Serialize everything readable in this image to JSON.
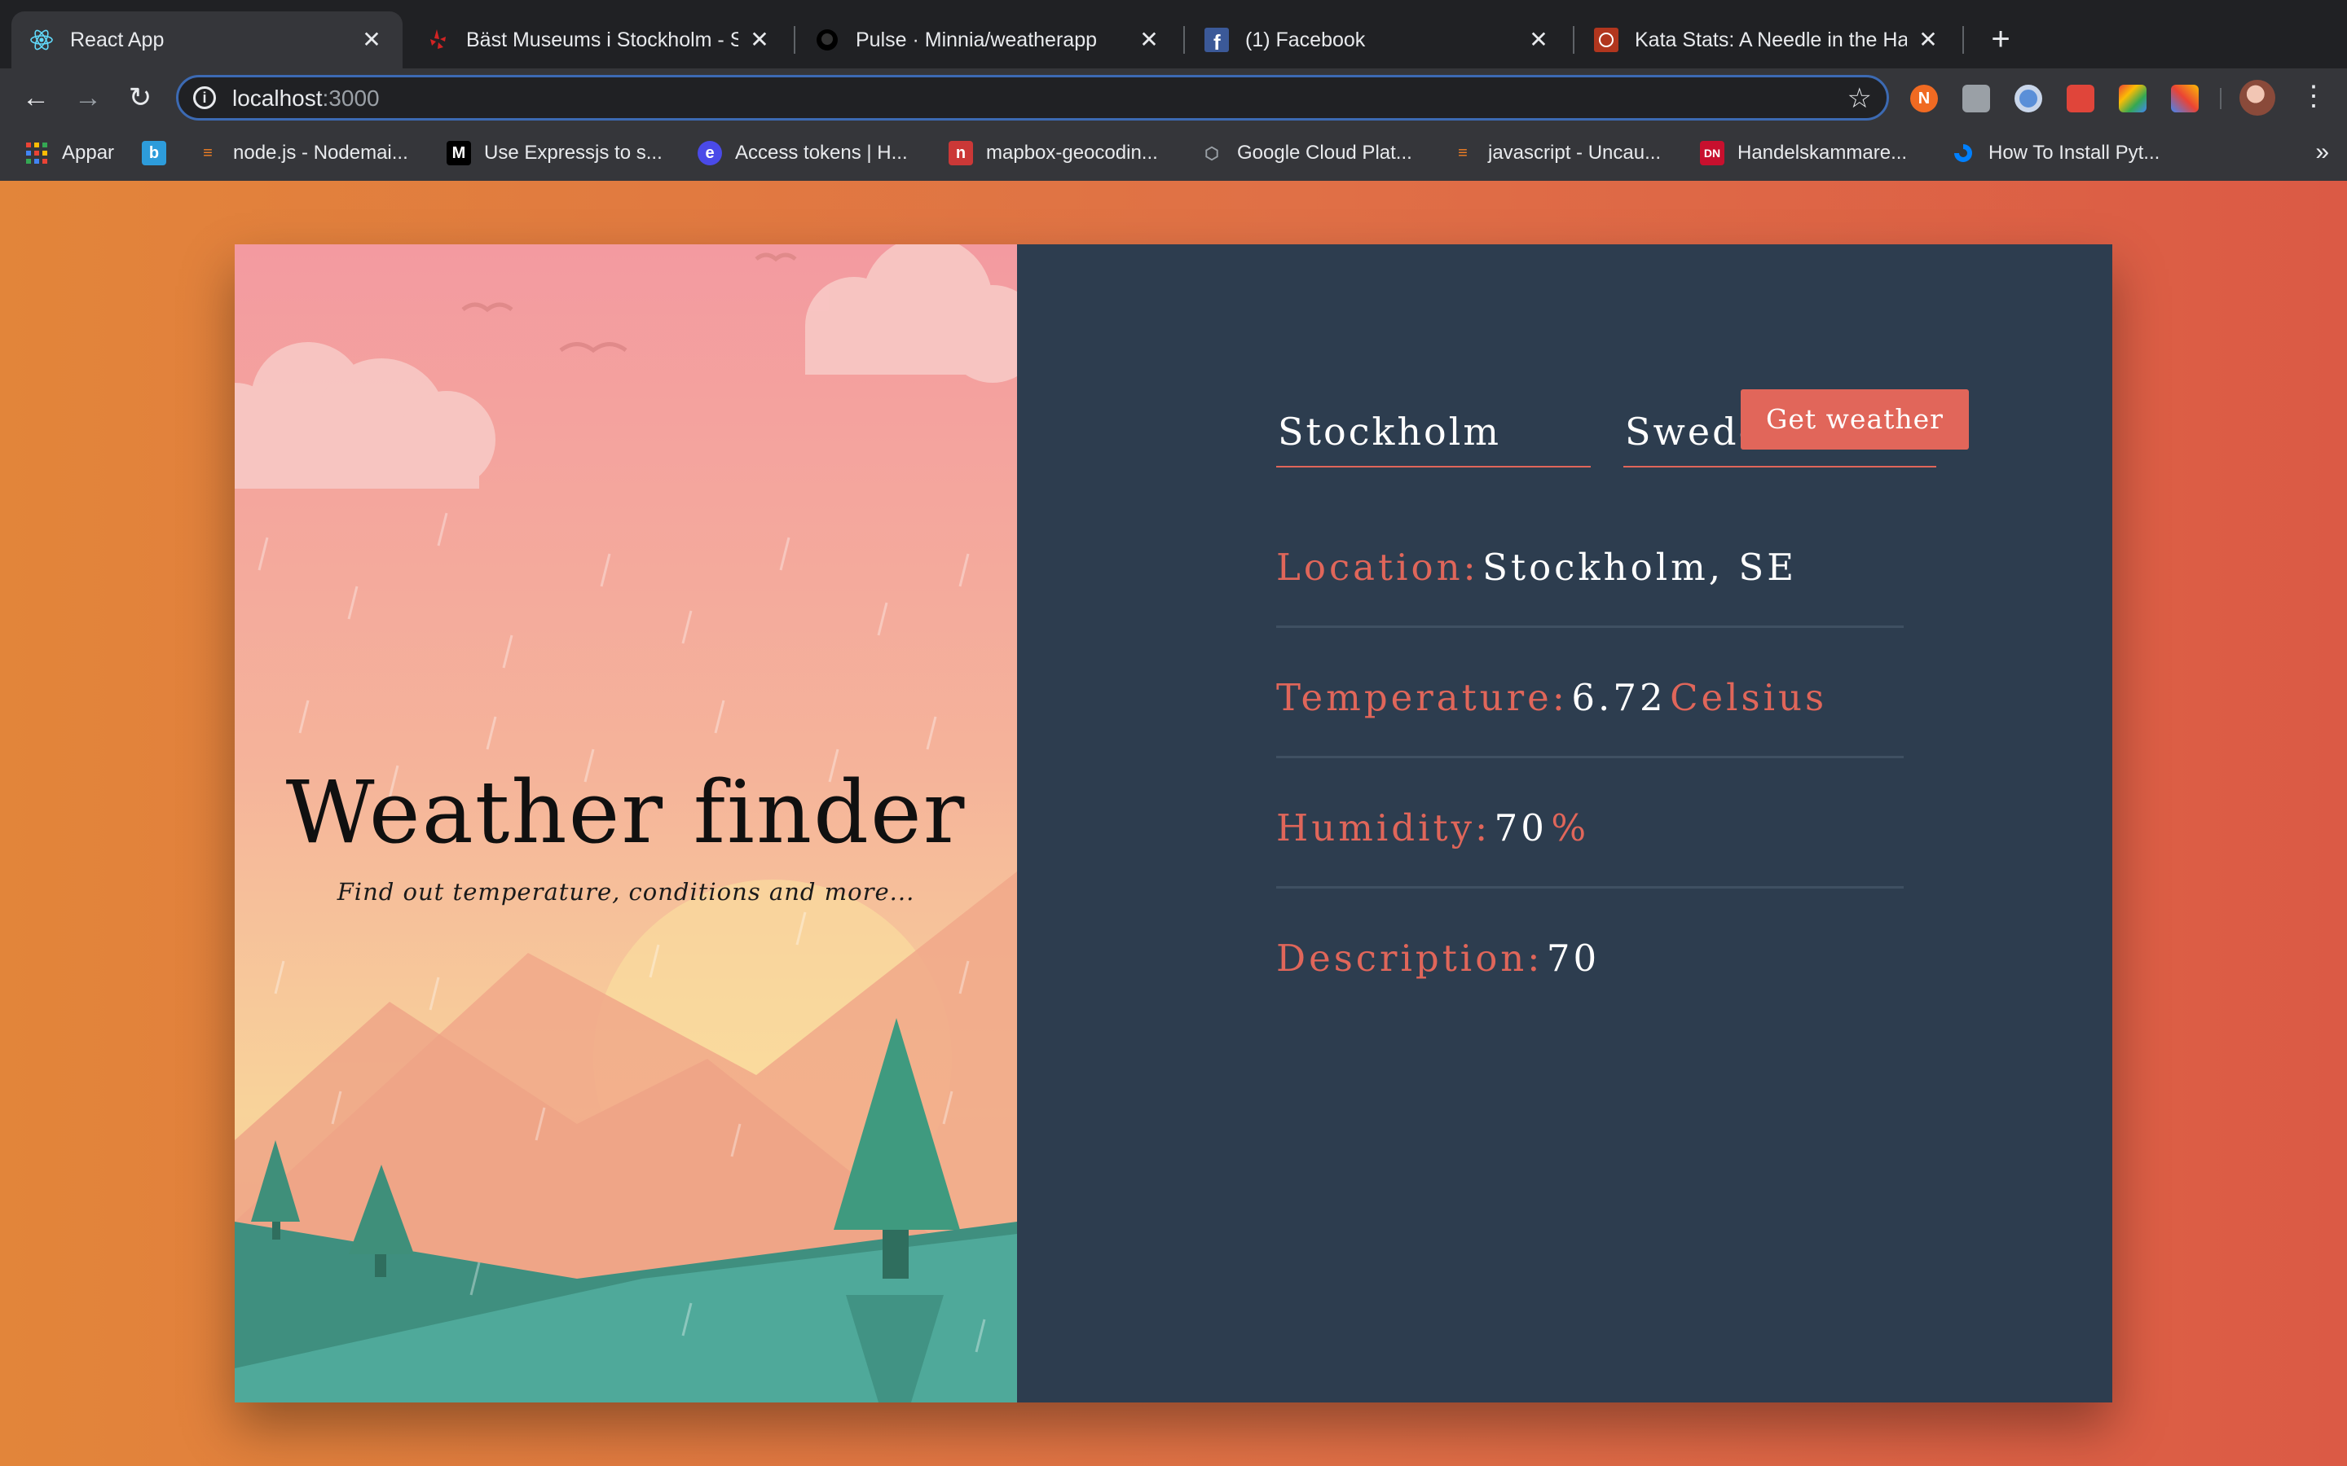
{
  "browser": {
    "tabs": [
      {
        "title": "React App",
        "favicon": "react-icon"
      },
      {
        "title": "Bäst Museums i Stockholm - S",
        "favicon": "yelp-icon"
      },
      {
        "title": "Pulse · Minnia/weatherapp",
        "favicon": "github-icon"
      },
      {
        "title": "(1) Facebook",
        "favicon": "facebook-icon"
      },
      {
        "title": "Kata Stats: A Needle in the Hay",
        "favicon": "codewars-icon"
      }
    ],
    "url_host": "localhost",
    "url_port": ":3000",
    "bookmarks": [
      {
        "label": "Appar",
        "icon": "apps-grid-icon"
      },
      {
        "label": "",
        "icon": "b-icon"
      },
      {
        "label": "node.js - Nodemai...",
        "icon": "stackoverflow-icon"
      },
      {
        "label": "Use Expressjs to s...",
        "icon": "medium-icon"
      },
      {
        "label": "Access tokens | H...",
        "icon": "heroku-icon"
      },
      {
        "label": "mapbox-geocodin...",
        "icon": "npm-icon"
      },
      {
        "label": "Google Cloud Plat...",
        "icon": "google-cloud-icon"
      },
      {
        "label": "javascript - Uncau...",
        "icon": "stackoverflow-icon"
      },
      {
        "label": "Handelskammare...",
        "icon": "dn-icon"
      },
      {
        "label": "How To Install Pyt...",
        "icon": "digitalocean-icon"
      }
    ],
    "more_bookmarks": "»"
  },
  "hero": {
    "title": "Weather finder",
    "subtitle": "Find out temperature, conditions and more..."
  },
  "form": {
    "city_value": "Stockholm",
    "country_value": "Sweden",
    "submit_label": "Get weather"
  },
  "results": {
    "location_label": "Location:",
    "location_value": "Stockholm, SE",
    "temperature_label": "Temperature:",
    "temperature_value": "6.72",
    "temperature_unit": "Celsius",
    "humidity_label": "Humidity:",
    "humidity_value": "70",
    "humidity_unit": "%",
    "description_label": "Description:",
    "description_value": "70"
  },
  "colors": {
    "accent": "#e0665a",
    "panel": "#2d3d4f",
    "page_gradient_start": "#e2853a",
    "page_gradient_end": "#db5a45"
  }
}
